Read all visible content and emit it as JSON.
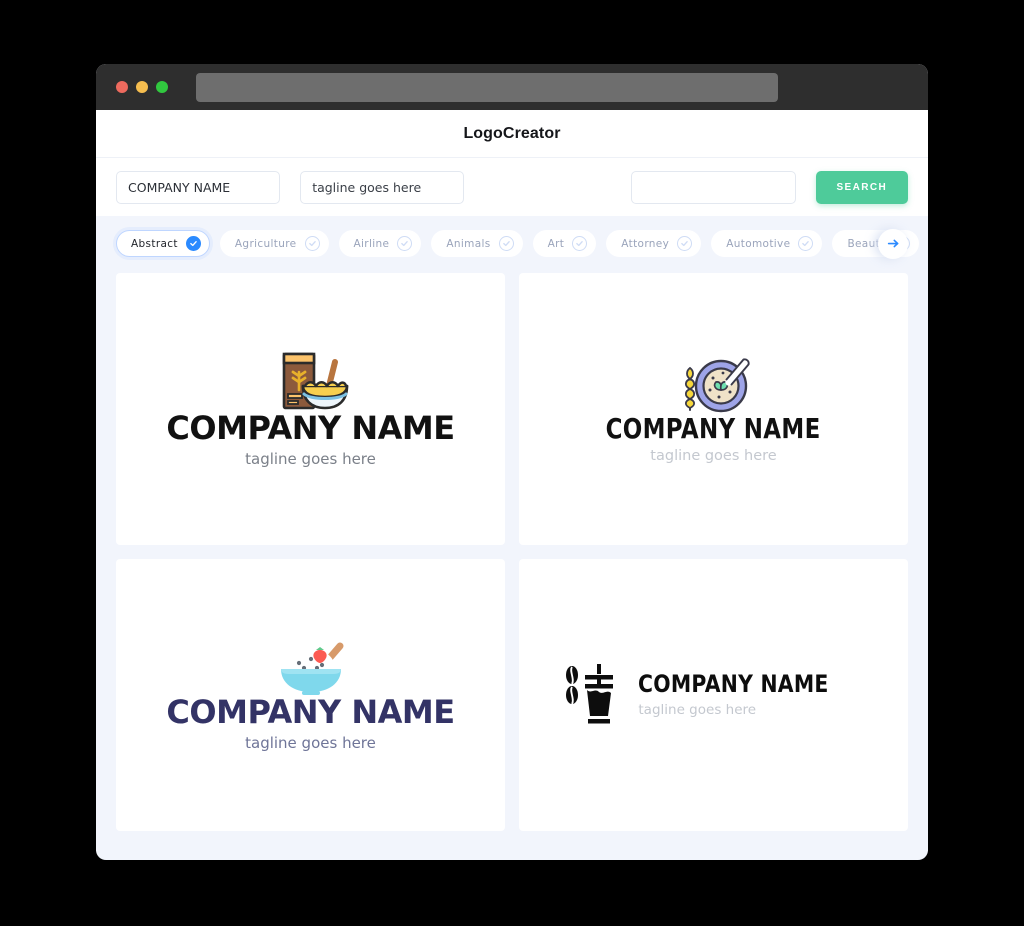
{
  "window": {
    "traffic_lights": [
      {
        "name": "close",
        "color": "#ed6a5e"
      },
      {
        "name": "minimize",
        "color": "#f5bd4f"
      },
      {
        "name": "maximize",
        "color": "#31c83f"
      }
    ],
    "url_value": ""
  },
  "header": {
    "title": "LogoCreator"
  },
  "search": {
    "company_value": "COMPANY NAME",
    "company_placeholder": "COMPANY NAME",
    "tagline_value": "tagline goes here",
    "tagline_placeholder": "tagline goes here",
    "extra_value": "",
    "extra_placeholder": "",
    "button_label": "SEARCH",
    "button_color": "#4ecb9a"
  },
  "categories": {
    "next_icon": "arrow-right-icon",
    "accent_color": "#2b8aff",
    "items": [
      {
        "label": "Abstract",
        "selected": true,
        "icon": "check-circle-icon"
      },
      {
        "label": "Agriculture",
        "selected": false,
        "icon": "check-circle-icon"
      },
      {
        "label": "Airline",
        "selected": false,
        "icon": "check-circle-icon"
      },
      {
        "label": "Animals",
        "selected": false,
        "icon": "check-circle-icon"
      },
      {
        "label": "Art",
        "selected": false,
        "icon": "check-circle-icon"
      },
      {
        "label": "Attorney",
        "selected": false,
        "icon": "check-circle-icon"
      },
      {
        "label": "Automotive",
        "selected": false,
        "icon": "check-circle-icon"
      },
      {
        "label": "Beauty",
        "selected": false,
        "icon": "check-circle-icon"
      }
    ]
  },
  "results": [
    {
      "icon_name": "cereal-box-and-bowl-icon",
      "name": "COMPANY NAME",
      "tagline": "tagline goes here",
      "name_color": "#111111",
      "tagline_color": "#7b8089",
      "layout": "stacked"
    },
    {
      "icon_name": "wheat-and-oatmeal-bowl-icon",
      "name": "COMPANY NAME",
      "tagline": "tagline goes here",
      "name_color": "#111111",
      "tagline_color": "#c4c8cf",
      "layout": "stacked"
    },
    {
      "icon_name": "bowl-with-strawberry-and-spoon-icon",
      "name": "COMPANY NAME",
      "tagline": "tagline goes here",
      "name_color": "#333366",
      "tagline_color": "#6f7598",
      "layout": "stacked"
    },
    {
      "icon_name": "coffee-beans-and-cup-icon",
      "name": "COMPANY NAME",
      "tagline": "tagline goes here",
      "name_color": "#0d0d0d",
      "tagline_color": "#c4c8cf",
      "layout": "horizontal"
    }
  ]
}
